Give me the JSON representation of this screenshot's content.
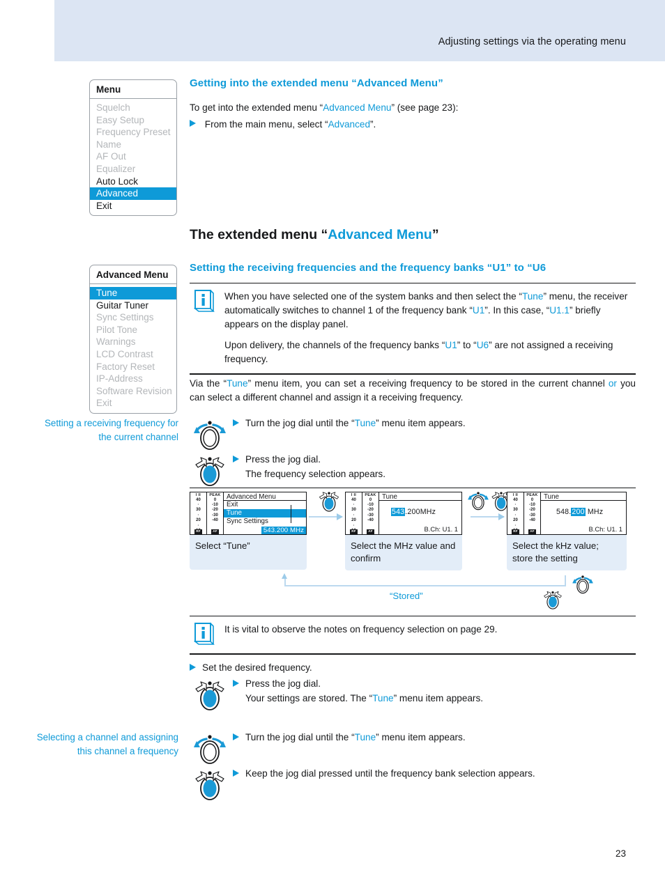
{
  "header": {
    "title": "Adjusting settings via the operating menu"
  },
  "page_number": "23",
  "main_menu": {
    "title": "Menu",
    "items": [
      {
        "label": "Squelch",
        "state": "dim"
      },
      {
        "label": "Easy Setup",
        "state": "dim"
      },
      {
        "label": "Frequency Preset",
        "state": "dim"
      },
      {
        "label": "Name",
        "state": "dim"
      },
      {
        "label": "AF Out",
        "state": "dim"
      },
      {
        "label": "Equalizer",
        "state": "dim"
      },
      {
        "label": "Auto Lock",
        "state": "normal"
      },
      {
        "label": "Advanced",
        "state": "selected"
      },
      {
        "label": "Exit",
        "state": "normal"
      }
    ]
  },
  "advanced_menu": {
    "title": "Advanced Menu",
    "items": [
      {
        "label": "Tune",
        "state": "selected"
      },
      {
        "label": "Guitar Tuner",
        "state": "normal"
      },
      {
        "label": "Sync Settings",
        "state": "dim"
      },
      {
        "label": "Pilot Tone",
        "state": "dim"
      },
      {
        "label": "Warnings",
        "state": "dim"
      },
      {
        "label": "LCD Contrast",
        "state": "dim"
      },
      {
        "label": "Factory Reset",
        "state": "dim"
      },
      {
        "label": "IP-Address",
        "state": "dim"
      },
      {
        "label": "Software Revision",
        "state": "dim"
      },
      {
        "label": "Exit",
        "state": "dim"
      }
    ]
  },
  "section_getting_in": {
    "heading_plain": "Getting into the extended menu “",
    "heading_accent": "Advanced Menu",
    "heading_tail": "”",
    "intro_a": "To get into the extended menu “",
    "intro_accent": "Advanced Menu",
    "intro_b": "” (see page 23):",
    "step_a": "From the main menu, select “",
    "step_accent": "Advanced",
    "step_b": "”."
  },
  "section_extended": {
    "title_plain": "The extended menu “",
    "title_accent": "Advanced Menu",
    "title_tail": "”",
    "subheading": "Setting the receiving frequencies and the frequency banks “U1” to “U6"
  },
  "note_top": {
    "p1_a": "When you have selected one of the system banks and then select the “",
    "p1_tune": "Tune",
    "p1_b": "” menu, the receiver automatically switches to channel 1 of the frequency bank “",
    "p1_u1": "U1",
    "p1_c": "”. In this case, “",
    "p1_u11": "U1.1",
    "p1_d": "” briefly appears on the display panel.",
    "p2_a": "Upon delivery, the channels of the frequency banks “",
    "p2_u1": "U1",
    "p2_b": "” to “",
    "p2_u6": "U6",
    "p2_c": "” are not assigned a receiving frequency."
  },
  "paragraph_via": {
    "a": "Via the “",
    "tune": "Tune",
    "b": "” menu item, you can set a receiving frequency to be stored in the current channel ",
    "or": "or",
    "c": " you can select a different channel and assign it a receiving frequency."
  },
  "margin_note_1": "Setting a receiving frequency for the current channel",
  "steps_1": [
    {
      "icon": "jog-dial-turn-icon",
      "a": "Turn the jog dial until the “",
      "accent": "Tune",
      "b": "” menu item appears.",
      "line2": ""
    },
    {
      "icon": "jog-dial-press-icon",
      "a": "Press the jog dial.",
      "accent": "",
      "b": "",
      "line2": "The frequency selection appears."
    }
  ],
  "flow": {
    "cards": [
      {
        "lcd_title": "Advanced Menu",
        "items": [
          {
            "label": "Exit",
            "selected": false
          },
          {
            "label": "Tune",
            "selected": true
          },
          {
            "label": "Sync Settings",
            "selected": false
          }
        ],
        "freq_badge": "543.200 MHz",
        "caption": "Select “Tune”"
      },
      {
        "lcd_title": "Tune",
        "value_prefix": "",
        "value_highlight": "543",
        "value_suffix": ".200MHz",
        "bch": "B.Ch: U1.  1",
        "caption": "Select the MHz value and confirm"
      },
      {
        "lcd_title": "Tune",
        "value_prefix": "548.",
        "value_highlight": "200",
        "value_suffix": " MHz",
        "bch": "B.Ch:  U1. 1",
        "caption": "Select the kHz value; store the setting"
      }
    ],
    "stored_label": "“Stored”",
    "meter": {
      "left_header": "I II",
      "right_header": "PEAK",
      "left_scale": [
        "40",
        "30",
        "20",
        "10"
      ],
      "right_scale": [
        "0",
        "-10",
        "-20",
        "-30",
        "-40"
      ],
      "left_tag": "RF",
      "right_tag": "AF"
    }
  },
  "note_bottom": {
    "text": "It is vital to observe the notes on frequency selection on page 29."
  },
  "steps_2": [
    {
      "icon": "",
      "a": "Set the desired frequency.",
      "accent": "",
      "b": "",
      "line2": ""
    },
    {
      "icon": "jog-dial-press-icon",
      "a": "Press the jog dial.",
      "accent": "",
      "b": "",
      "line2_a": "Your settings are stored. The “",
      "line2_accent": "Tune",
      "line2_b": "” menu item appears."
    }
  ],
  "margin_note_2": "Selecting a channel and assigning this channel a frequency",
  "steps_3": [
    {
      "icon": "jog-dial-turn-icon",
      "a": "Turn the jog dial until the “",
      "accent": "Tune",
      "b": "” menu item appears."
    },
    {
      "icon": "jog-dial-press-icon",
      "a": "Keep the jog dial pressed until the frequency bank selection appears.",
      "accent": "",
      "b": ""
    }
  ],
  "colors": {
    "accent": "#0e9ad8",
    "header_band": "#dce5f3",
    "caption_bg": "#e3edf8",
    "text": "#17181a",
    "dim": "#b3b6b9"
  }
}
